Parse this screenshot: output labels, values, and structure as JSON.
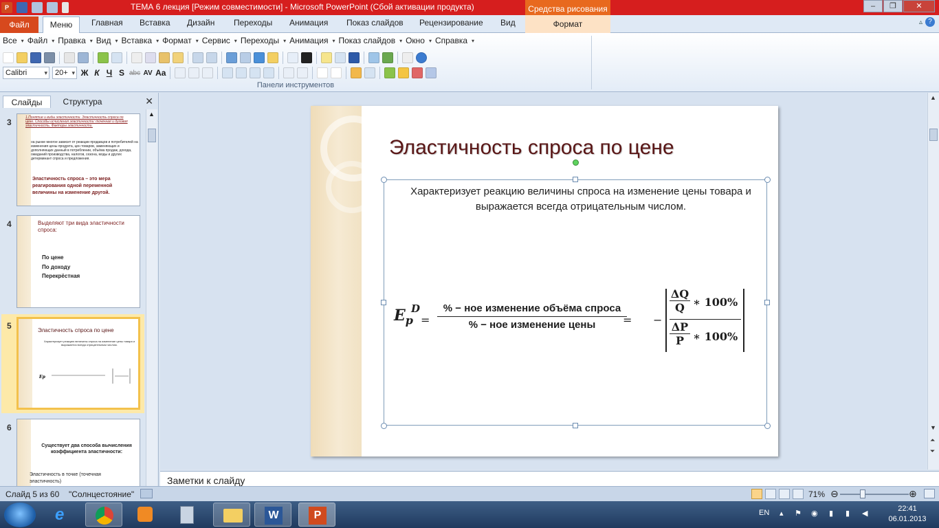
{
  "window": {
    "title": "ТЕМА 6  лекция [Режим совместимости]  -  Microsoft PowerPoint (Сбой активации продукта)",
    "context_tab_group": "Средства рисования",
    "app_icon_letter": "P"
  },
  "ribbon_tabs": {
    "file": "Файл",
    "active": "Меню",
    "items": [
      "Главная",
      "Вставка",
      "Дизайн",
      "Переходы",
      "Анимация",
      "Показ слайдов",
      "Рецензирование",
      "Вид"
    ],
    "format": "Формат"
  },
  "menu_row": [
    "Все",
    "Файл",
    "Правка",
    "Вид",
    "Вставка",
    "Формат",
    "Сервис",
    "Переходы",
    "Анимация",
    "Показ слайдов",
    "Окно",
    "Справка"
  ],
  "font": {
    "name": "Calibri",
    "size": "20+",
    "bold": "Ж",
    "italic": "К",
    "underline": "Ч",
    "shadow": "S",
    "strike": "abc",
    "spacing": "AV",
    "case": "Aa"
  },
  "ribbon_group_label": "Панели инструментов",
  "left_pane": {
    "tab_slides": "Слайды",
    "tab_outline": "Структура",
    "close": "✕"
  },
  "thumbnails": [
    {
      "number": "3",
      "title": "1.Понятие и виды эластичности. Эластичность спроса по цене. Способы исчисления эластичности: точечная и дуговая эластичность.  Факторы эластичности.",
      "body": "на рынке многое зависит от реакции продавцов и потребителей на изменения цены продукта, цен товаров, заменяющих и дополняющих данный в потреблении, объёма продаж, дохода, ожиданий производства, налогов, сезона, моды и других детерминант спроса и предложения.",
      "highlight": "Эластичность спроса  – это мера реагирования одной переменной величины на изменение другой."
    },
    {
      "number": "4",
      "title": "Выделяют три вида эластичности спроса:",
      "items": [
        "По цене",
        "По доходу",
        "Перекрёстная"
      ]
    },
    {
      "number": "5",
      "title": "Эластичность спроса по цене",
      "body": "Характеризует реакцию величины спроса на изменение цены товара и выражается всегда отрицательным числом."
    },
    {
      "number": "6",
      "title": "Существует два способа вычисления коэффициента эластичности:",
      "items": [
        "Эластичность  в точке (точечная эластичность)"
      ]
    }
  ],
  "slide": {
    "title": "Эластичность спроса по цене",
    "body": "Характеризует реакцию величины спроса на изменение цены товара и выражается всегда отрицательным числом.",
    "formula": {
      "lhs": "E",
      "lhs_sub": "p",
      "lhs_sup": "D",
      "equals": "=",
      "numerator": "% − ное изменение объёма спроса",
      "denominator": "% − ное изменение цены",
      "minus": "−",
      "inner_num_top": "ΔQ",
      "inner_num_bottom": "Q",
      "inner_den_top": "ΔP",
      "inner_den_bottom": "P",
      "times_100": "∗ 100%"
    }
  },
  "notes": {
    "placeholder": "Заметки к слайду"
  },
  "status": {
    "slide_counter": "Слайд 5 из 60",
    "theme": "\"Солнцестояние\"",
    "zoom": "71%"
  },
  "taskbar": {
    "language": "EN",
    "time": "22:41",
    "date": "06.01.2013"
  },
  "colors": {
    "title_bar": "#d61e1e",
    "context_tab": "#e8691e",
    "file_tab": "#d7491d",
    "slide_title": "#5a1717"
  }
}
